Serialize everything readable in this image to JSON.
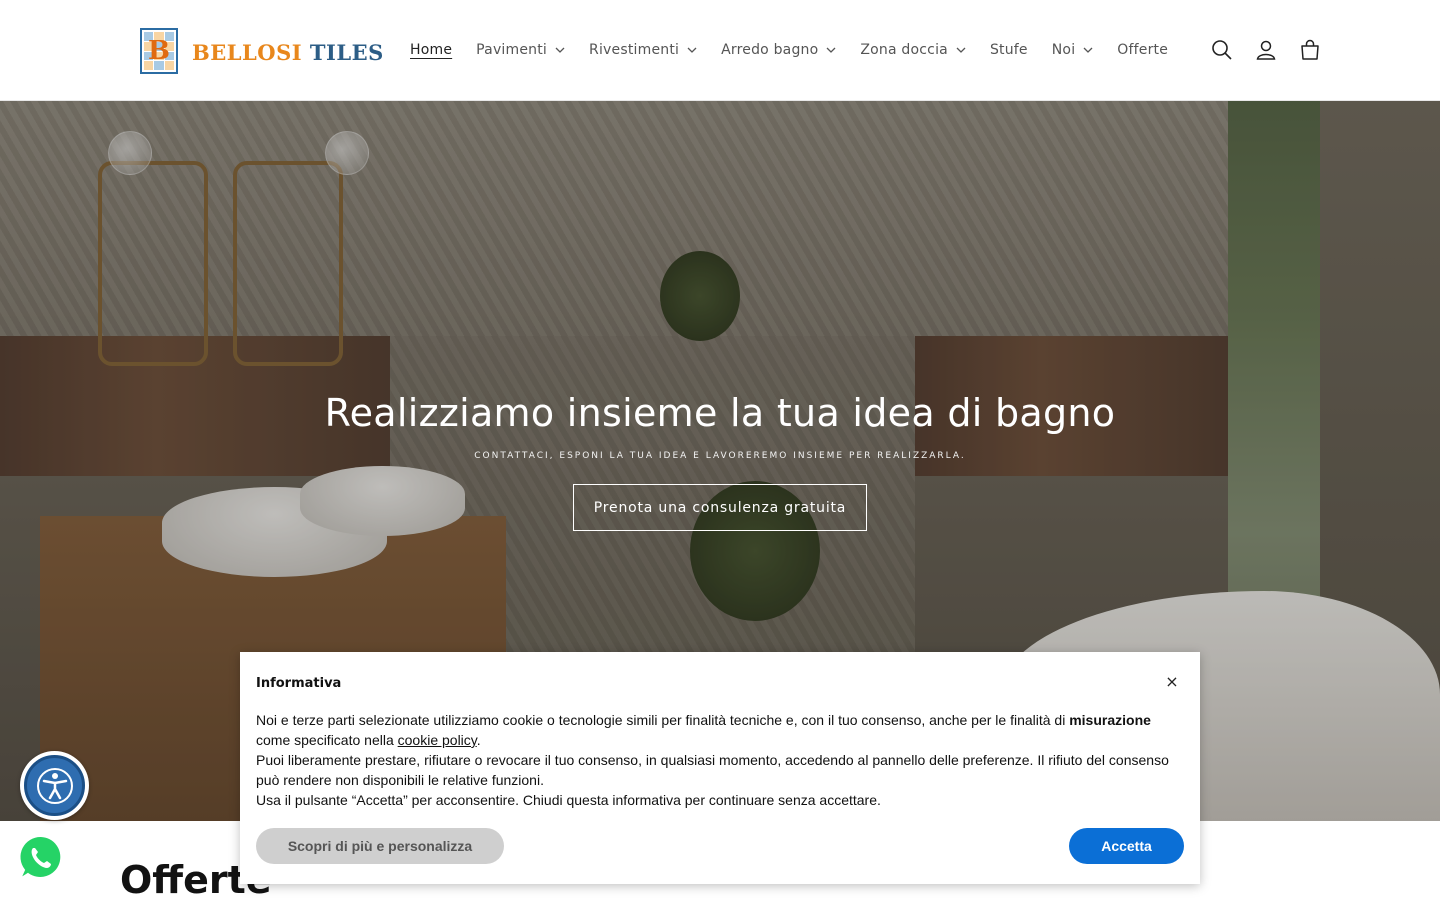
{
  "header": {
    "logo": {
      "mark_letter": "B",
      "word1": "BELLOSI",
      "word2": "TILES"
    },
    "nav": [
      {
        "label": "Home",
        "active": true,
        "dropdown": false
      },
      {
        "label": "Pavimenti",
        "active": false,
        "dropdown": true
      },
      {
        "label": "Rivestimenti",
        "active": false,
        "dropdown": true
      },
      {
        "label": "Arredo bagno",
        "active": false,
        "dropdown": true
      },
      {
        "label": "Zona doccia",
        "active": false,
        "dropdown": true
      },
      {
        "label": "Stufe",
        "active": false,
        "dropdown": false
      },
      {
        "label": "Noi",
        "active": false,
        "dropdown": true
      },
      {
        "label": "Offerte",
        "active": false,
        "dropdown": false
      }
    ],
    "icons": [
      "search-icon",
      "account-icon",
      "cart-icon"
    ]
  },
  "hero": {
    "title": "Realizziamo insieme la tua idea di bagno",
    "subtitle": "CONTATTACI, ESPONI LA TUA IDEA E LAVOREREMO INSIEME PER REALIZZARLA.",
    "button": "Prenota una consulenza gratuita"
  },
  "section": {
    "title": "Offerte"
  },
  "cookie": {
    "title": "Informativa",
    "close": "×",
    "p1_pre": "Noi e terze parti selezionate utilizziamo cookie o tecnologie simili per finalità tecniche e, con il tuo consenso, anche per le finalità di ",
    "p1_bold": "misurazione",
    "p1_mid": " come specificato nella ",
    "p1_link": "cookie policy",
    "p1_end": ".",
    "p2": "Puoi liberamente prestare, rifiutare o revocare il tuo consenso, in qualsiasi momento, accedendo al pannello delle preferenze. Il rifiuto del consenso può rendere non disponibili le relative funzioni.",
    "p3": "Usa il pulsante “Accetta” per acconsentire. Chiudi questa informativa per continuare senza accettare.",
    "btn_more": "Scopri di più e personalizza",
    "btn_accept": "Accetta"
  },
  "colors": {
    "accent_blue": "#0b6fd6",
    "logo_orange": "#e8871c",
    "logo_blue": "#2c5d86",
    "a11y_blue": "#2e6db0",
    "whatsapp_green": "#25d366"
  }
}
